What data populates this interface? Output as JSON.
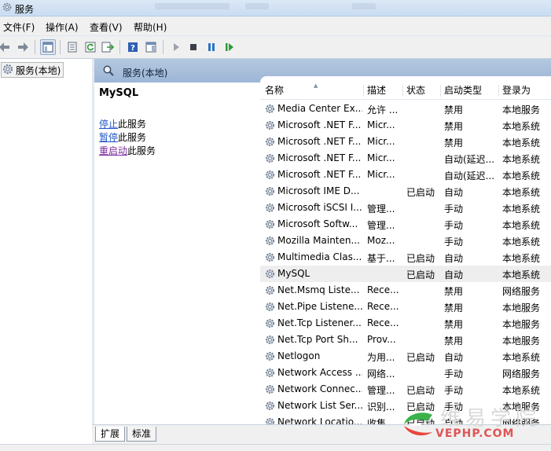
{
  "window": {
    "title": "服务"
  },
  "menu": [
    "文件(F)",
    "操作(A)",
    "查看(V)",
    "帮助(H)"
  ],
  "tree": {
    "root_label": "服务(本地)"
  },
  "panel": {
    "title": "服务(本地)"
  },
  "detail": {
    "service_name": "MySQL",
    "actions": [
      {
        "link": "停止",
        "rest": "此服务"
      },
      {
        "link": "暂停",
        "rest": "此服务"
      },
      {
        "link": "重启动",
        "rest": "此服务"
      }
    ]
  },
  "columns": [
    "名称",
    "描述",
    "状态",
    "启动类型",
    "登录为"
  ],
  "services": [
    {
      "name": "Media Center Ex...",
      "desc": "允许 ...",
      "status": "",
      "startup": "禁用",
      "logon": "本地服务"
    },
    {
      "name": "Microsoft .NET F...",
      "desc": "Micr...",
      "status": "",
      "startup": "禁用",
      "logon": "本地系统"
    },
    {
      "name": "Microsoft .NET F...",
      "desc": "Micr...",
      "status": "",
      "startup": "禁用",
      "logon": "本地系统"
    },
    {
      "name": "Microsoft .NET F...",
      "desc": "Micr...",
      "status": "",
      "startup": "自动(延迟...",
      "logon": "本地系统"
    },
    {
      "name": "Microsoft .NET F...",
      "desc": "Micr...",
      "status": "",
      "startup": "自动(延迟...",
      "logon": "本地系统"
    },
    {
      "name": "Microsoft IME D...",
      "desc": "",
      "status": "已启动",
      "startup": "自动",
      "logon": "本地系统"
    },
    {
      "name": "Microsoft iSCSI I...",
      "desc": "管理...",
      "status": "",
      "startup": "手动",
      "logon": "本地系统"
    },
    {
      "name": "Microsoft Softw...",
      "desc": "管理...",
      "status": "",
      "startup": "手动",
      "logon": "本地系统"
    },
    {
      "name": "Mozilla Mainten...",
      "desc": "Moz...",
      "status": "",
      "startup": "手动",
      "logon": "本地系统"
    },
    {
      "name": "Multimedia Clas...",
      "desc": "基于...",
      "status": "已启动",
      "startup": "自动",
      "logon": "本地系统"
    },
    {
      "name": "MySQL",
      "desc": "",
      "status": "已启动",
      "startup": "自动",
      "logon": "本地系统"
    },
    {
      "name": "Net.Msmq Liste...",
      "desc": "Rece...",
      "status": "",
      "startup": "禁用",
      "logon": "网络服务"
    },
    {
      "name": "Net.Pipe Listene...",
      "desc": "Rece...",
      "status": "",
      "startup": "禁用",
      "logon": "本地服务"
    },
    {
      "name": "Net.Tcp Listener...",
      "desc": "Rece...",
      "status": "",
      "startup": "禁用",
      "logon": "本地服务"
    },
    {
      "name": "Net.Tcp Port Sh...",
      "desc": "Prov...",
      "status": "",
      "startup": "禁用",
      "logon": "本地服务"
    },
    {
      "name": "Netlogon",
      "desc": "为用...",
      "status": "已启动",
      "startup": "自动",
      "logon": "本地系统"
    },
    {
      "name": "Network Access ...",
      "desc": "网络...",
      "status": "",
      "startup": "手动",
      "logon": "网络服务"
    },
    {
      "name": "Network Connec...",
      "desc": "管理...",
      "status": "已启动",
      "startup": "手动",
      "logon": "本地系统"
    },
    {
      "name": "Network List Ser...",
      "desc": "识别...",
      "status": "已启动",
      "startup": "手动",
      "logon": "本地服务"
    },
    {
      "name": "Network Locatio...",
      "desc": "收集...",
      "status": "已启动",
      "startup": "自动",
      "logon": "网络服务"
    }
  ],
  "selected_index": 10,
  "tabs": [
    "扩展",
    "标准"
  ],
  "watermark": {
    "text": "维易学院",
    "url": "VEPHP.COM"
  },
  "colors": {
    "header": "#a9c0dd",
    "link": "#1f56c7",
    "link_visited": "#7a2a9c",
    "selected_row": "#eeeeef"
  }
}
